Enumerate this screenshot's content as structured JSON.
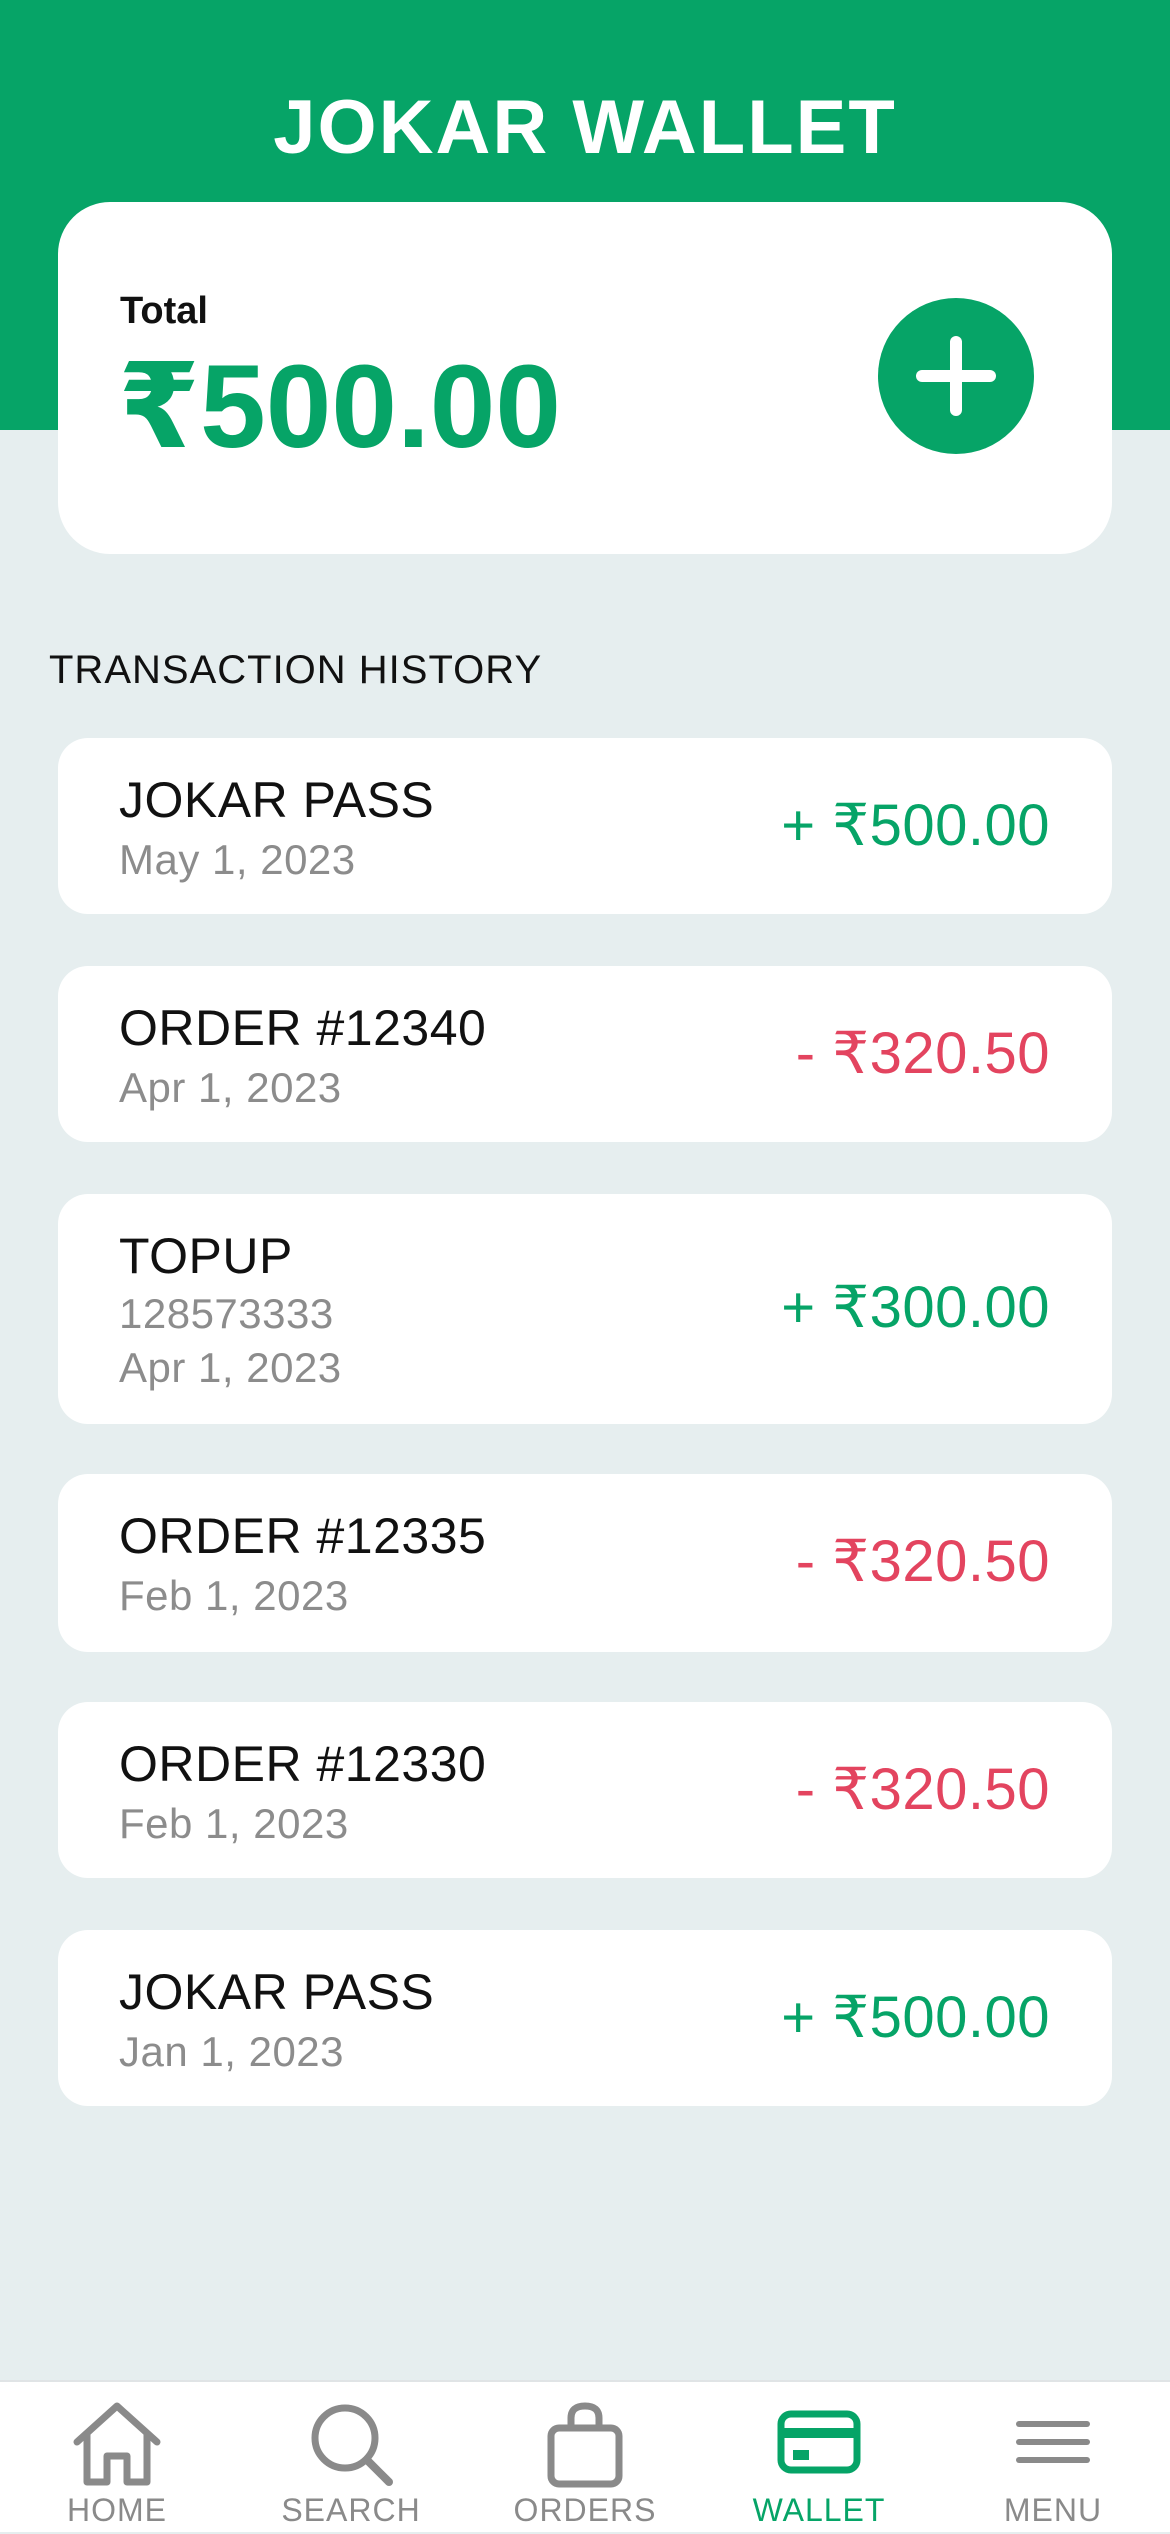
{
  "header": {
    "title": "JOKAR WALLET"
  },
  "balance": {
    "label": "Total",
    "amount": "₹500.00",
    "add_button_icon": "plus-icon"
  },
  "transactions": {
    "section_title": "TRANSACTION HISTORY",
    "items": [
      {
        "title": "JOKAR PASS",
        "date": "May 1, 2023",
        "amount": "+ ₹500.00",
        "type": "credit"
      },
      {
        "title": "ORDER #12340",
        "date": "Apr 1, 2023",
        "amount": "- ₹320.50",
        "type": "debit"
      },
      {
        "title": "TOPUP",
        "reference": "128573333",
        "date": "Apr 1, 2023",
        "amount": "+ ₹300.00",
        "type": "credit"
      },
      {
        "title": "ORDER #12335",
        "date": "Feb 1, 2023",
        "amount": "- ₹320.50",
        "type": "debit"
      },
      {
        "title": "ORDER #12330",
        "date": "Feb 1, 2023",
        "amount": "- ₹320.50",
        "type": "debit"
      },
      {
        "title": "JOKAR PASS",
        "date": "Jan 1, 2023",
        "amount": "+ ₹500.00",
        "type": "credit"
      }
    ]
  },
  "tab_bar": {
    "active": "WALLET",
    "tabs": [
      {
        "label": "HOME",
        "icon": "home-icon"
      },
      {
        "label": "SEARCH",
        "icon": "search-icon"
      },
      {
        "label": "ORDERS",
        "icon": "shopping-bag-icon"
      },
      {
        "label": "WALLET",
        "icon": "wallet-card-icon"
      },
      {
        "label": "MENU",
        "icon": "hamburger-menu-icon"
      }
    ]
  },
  "colors": {
    "brand_green": "#06a467",
    "debit_red": "#e3445f",
    "background": "#e6eeef",
    "muted_text": "#8c8c8c",
    "inactive_tab": "#8a8a8a"
  }
}
